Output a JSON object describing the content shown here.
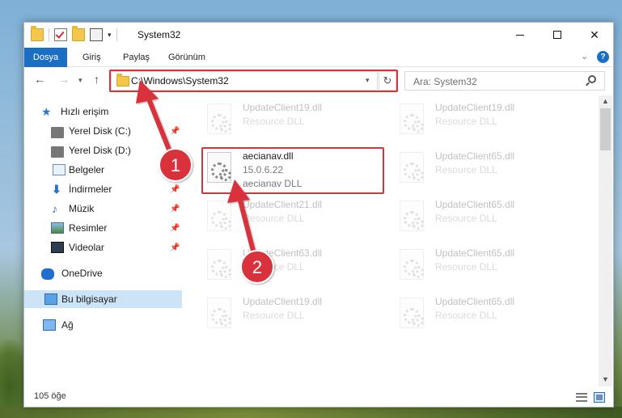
{
  "window": {
    "title": "System32"
  },
  "ribbon": {
    "tabs": [
      "Dosya",
      "Giriş",
      "Paylaş",
      "Görünüm"
    ],
    "help_label": "?"
  },
  "navbar": {
    "address": "C:\\Windows\\System32",
    "search_placeholder": "Ara: System32"
  },
  "sidebar": {
    "items": [
      {
        "label": "Hızlı erişim",
        "icon": "star-icon"
      },
      {
        "label": "Yerel Disk (C:)",
        "icon": "drive-icon",
        "pinned": true
      },
      {
        "label": "Yerel Disk (D:)",
        "icon": "drive-icon"
      },
      {
        "label": "Belgeler",
        "icon": "documents-icon"
      },
      {
        "label": "İndirmeler",
        "icon": "downloads-icon",
        "pinned": true
      },
      {
        "label": "Müzik",
        "icon": "music-icon",
        "pinned": true
      },
      {
        "label": "Resimler",
        "icon": "pictures-icon",
        "pinned": true
      },
      {
        "label": "Videolar",
        "icon": "videos-icon",
        "pinned": true
      },
      {
        "label": "OneDrive",
        "icon": "onedrive-icon"
      },
      {
        "label": "Bu bilgisayar",
        "icon": "this-pc-icon",
        "selected": true
      },
      {
        "label": "Ağ",
        "icon": "network-icon"
      }
    ]
  },
  "files": [
    {
      "name": "UpdateClient19.dll",
      "desc": "Resource DLL"
    },
    {
      "name": "UpdateClient19.dll",
      "desc": "Resource DLL"
    },
    {
      "name": "aecianav.dll",
      "version": "15.0.6.22",
      "desc": "aecianav DLL"
    },
    {
      "name": "UpdateClient65.dll",
      "desc": "Resource DLL"
    },
    {
      "name": "UpdateClient21.dll",
      "desc": "Resource DLL"
    },
    {
      "name": "UpdateClient65.dll",
      "desc": "Resource DLL"
    },
    {
      "name": "UpdateClient63.dll",
      "desc": "Resource DLL"
    },
    {
      "name": "UpdateClient65.dll",
      "desc": "Resource DLL"
    },
    {
      "name": "UpdateClient19.dll",
      "desc": "Resource DLL"
    },
    {
      "name": "UpdateClient65.dll",
      "desc": "Resource DLL"
    }
  ],
  "status": {
    "item_count": "105 öğe"
  },
  "annotations": {
    "step1": "1",
    "step2": "2",
    "color": "#d9323d"
  }
}
